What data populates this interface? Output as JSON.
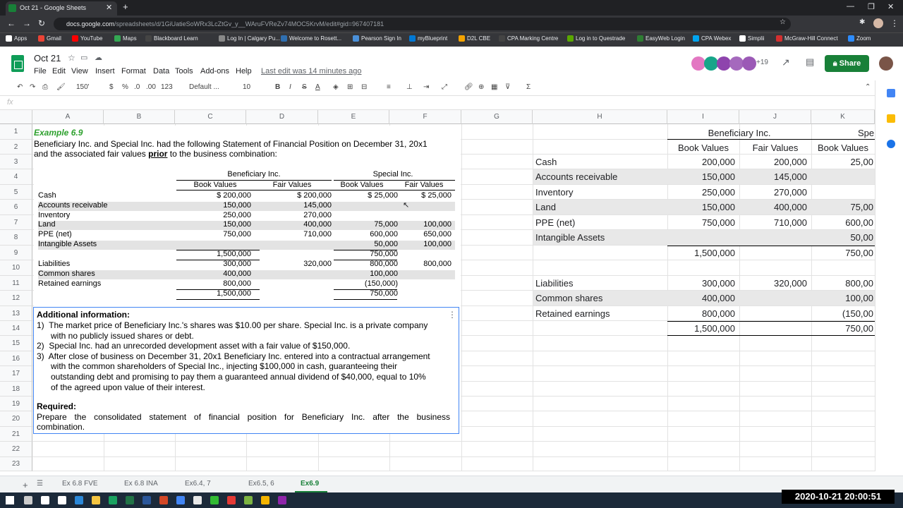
{
  "browser": {
    "tab_title": "Oct 21 - Google Sheets",
    "url_host": "docs.google.com",
    "url_path": "/spreadsheets/d/1GiUatieSoWRx3LcZtGv_y__WAruFVReZv74MOC5KrvM/edit#gid=967407181",
    "bookmarks": [
      "Apps",
      "Gmail",
      "YouTube",
      "Maps",
      "Blackboard Learn",
      "Log In | Calgary Pu...",
      "Welcome to Rosett...",
      "Pearson Sign In",
      "myBlueprint",
      "D2L CBE",
      "CPA Marking Centre",
      "Log in to Questrade",
      "EasyWeb Login",
      "CPA Webex",
      "Simplii",
      "McGraw-Hill Connect",
      "Zoom"
    ]
  },
  "doc": {
    "title": "Oct 21",
    "menus": [
      "File",
      "Edit",
      "View",
      "Insert",
      "Format",
      "Data",
      "Tools",
      "Add-ons",
      "Help"
    ],
    "last_edit": "Last edit was 14 minutes ago",
    "collab_more": "+19",
    "share": "Share"
  },
  "toolbar": {
    "zoom": "150'",
    "percent": "%",
    "dec0": ".0",
    "dec00": ".00",
    "fmt123": "123",
    "font": "Default ...",
    "size": "10",
    "bold": "B",
    "italic": "I",
    "strike": "S",
    "textcolor": "A",
    "sigma": "Σ"
  },
  "columns": [
    "A",
    "B",
    "C",
    "D",
    "E",
    "F",
    "G",
    "H",
    "I",
    "J",
    "K"
  ],
  "rows": [
    "1",
    "2",
    "3",
    "4",
    "5",
    "6",
    "7",
    "8",
    "9",
    "10",
    "11",
    "12",
    "13",
    "14",
    "15",
    "16",
    "17",
    "18",
    "19",
    "20",
    "21",
    "22",
    "23"
  ],
  "embedded": {
    "example": "Example 6.9",
    "intro1": "Beneficiary Inc. and Special Inc. had the following Statement of Financial Position on December 31, 20x1",
    "intro2a": "and the associated fair values ",
    "intro2b": "prior",
    "intro2c": " to the business combination:",
    "co1": "Beneficiary Inc.",
    "co2": "Special Inc.",
    "heads": [
      "Book Values",
      "Fair Values",
      "Book Values",
      "Fair Values"
    ],
    "labels": [
      "Cash",
      "Accounts receivable",
      "Inventory",
      "Land",
      "PPE (net)",
      "Intangible Assets",
      "",
      "Liabilities",
      "Common shares",
      "Retained earnings",
      ""
    ],
    "bbv": [
      "$ 200,000",
      "150,000",
      "250,000",
      "150,000",
      "750,000",
      "",
      "1,500,000",
      "300,000",
      "400,000",
      "800,000",
      "1,500,000"
    ],
    "bfv": [
      "$ 200,000",
      "145,000",
      "270,000",
      "400,000",
      "710,000",
      "",
      "",
      "320,000",
      "",
      "",
      ""
    ],
    "sbv": [
      "$ 25,000",
      "",
      "",
      "75,000",
      "600,000",
      "50,000",
      "750,000",
      "800,000",
      "100,000",
      "(150,000)",
      "750,000"
    ],
    "sfv": [
      "$ 25,000",
      "",
      "",
      "100,000",
      "650,000",
      "100,000",
      "",
      "800,000",
      "",
      "",
      ""
    ],
    "addl": "Additional information:",
    "items": [
      "1)  The market price of Beneficiary Inc.'s shares was $10.00 per share. Special Inc. is a private company",
      "      with no publicly issued shares or debt.",
      "2)  Special Inc. had an unrecorded development asset with a fair value of $150,000.",
      "3)  After close of business on December 31, 20x1 Beneficiary Inc. entered into a contractual arrangement",
      "      with the common shareholders of Special Inc., injecting $100,000 in cash, guaranteeing their",
      "      outstanding debt and promising to pay them a guaranteed annual dividend of $40,000, equal to 10%",
      "      of the agreed upon value of their interest."
    ],
    "required": "Required:",
    "req1": "Prepare the consolidated statement of financial position for Beneficiary Inc. after the business",
    "req2": "combination."
  },
  "grid": {
    "header_i": "Beneficiary Inc.",
    "header_k": "Spe",
    "subheads": [
      "Book Values",
      "Fair Values",
      "Book Values"
    ],
    "labels": [
      "Cash",
      "Accounts receivable",
      "Inventory",
      "Land",
      "PPE (net)",
      "Intangible Assets",
      "",
      "",
      "Liabilities",
      "Common shares",
      "Retained earnings",
      ""
    ],
    "i": [
      "200,000",
      "150,000",
      "250,000",
      "150,000",
      "750,000",
      "",
      "1,500,000",
      "",
      "300,000",
      "400,000",
      "800,000",
      "1,500,000"
    ],
    "j": [
      "200,000",
      "145,000",
      "270,000",
      "400,000",
      "710,000",
      "",
      "",
      "",
      "320,000",
      "",
      "",
      ""
    ],
    "k": [
      "25,00",
      "",
      "",
      "75,00",
      "600,00",
      "50,00",
      "750,00",
      "",
      "800,00",
      "100,00",
      "(150,00",
      "750,00"
    ]
  },
  "sheets": [
    "Ex 6.8 FVE",
    "Ex 6.8 INA",
    "Ex6.4, 7",
    "Ex6.5, 6",
    "Ex6.9"
  ],
  "clock": "2020-10-21  20:00:51"
}
